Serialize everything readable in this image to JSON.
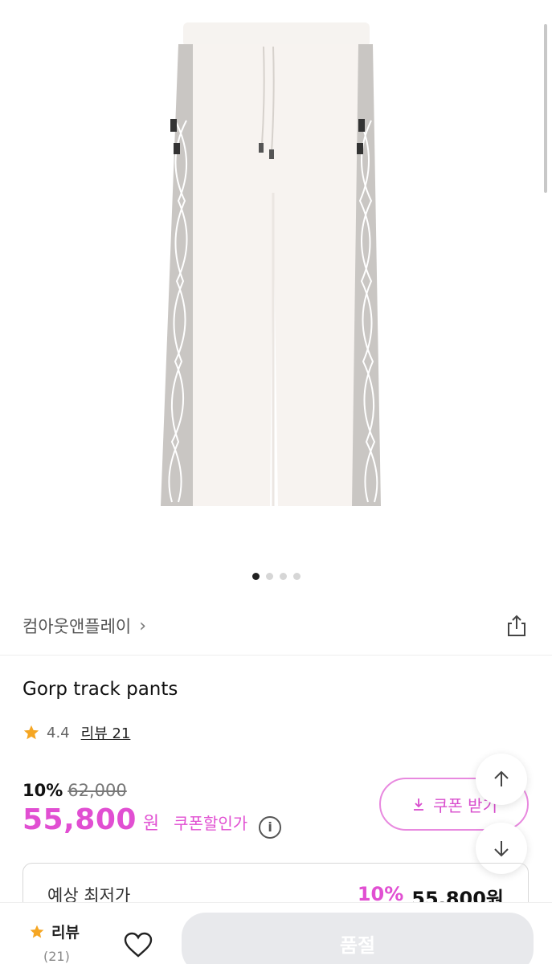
{
  "gallery": {
    "image_count": 4,
    "active_index": 0
  },
  "brand": {
    "name": "컴아웃앤플레이",
    "chevron": "›"
  },
  "product": {
    "name": "Gorp track pants",
    "rating": "4.4",
    "review_link": "리뷰 21"
  },
  "price": {
    "discount_rate": "10%",
    "original": "62,000",
    "sale": "55,800",
    "currency": "원",
    "coupon_label": "쿠폰할인가",
    "info": "i"
  },
  "coupon_button": {
    "label": "쿠폰 받기"
  },
  "estimate": {
    "label": "예상 최저가",
    "rate": "10%",
    "price": "55,800원"
  },
  "bottom_bar": {
    "review_label": "리뷰",
    "review_count": "(21)",
    "soldout_label": "품절"
  },
  "colors": {
    "accent": "#e14fd2",
    "star": "#f5a623"
  },
  "icons": {
    "share": "share-icon",
    "star": "star-icon",
    "heart": "heart-icon",
    "arrow_up": "arrow-up-icon",
    "arrow_down": "arrow-down-icon",
    "download": "download-icon",
    "info": "info-icon"
  }
}
